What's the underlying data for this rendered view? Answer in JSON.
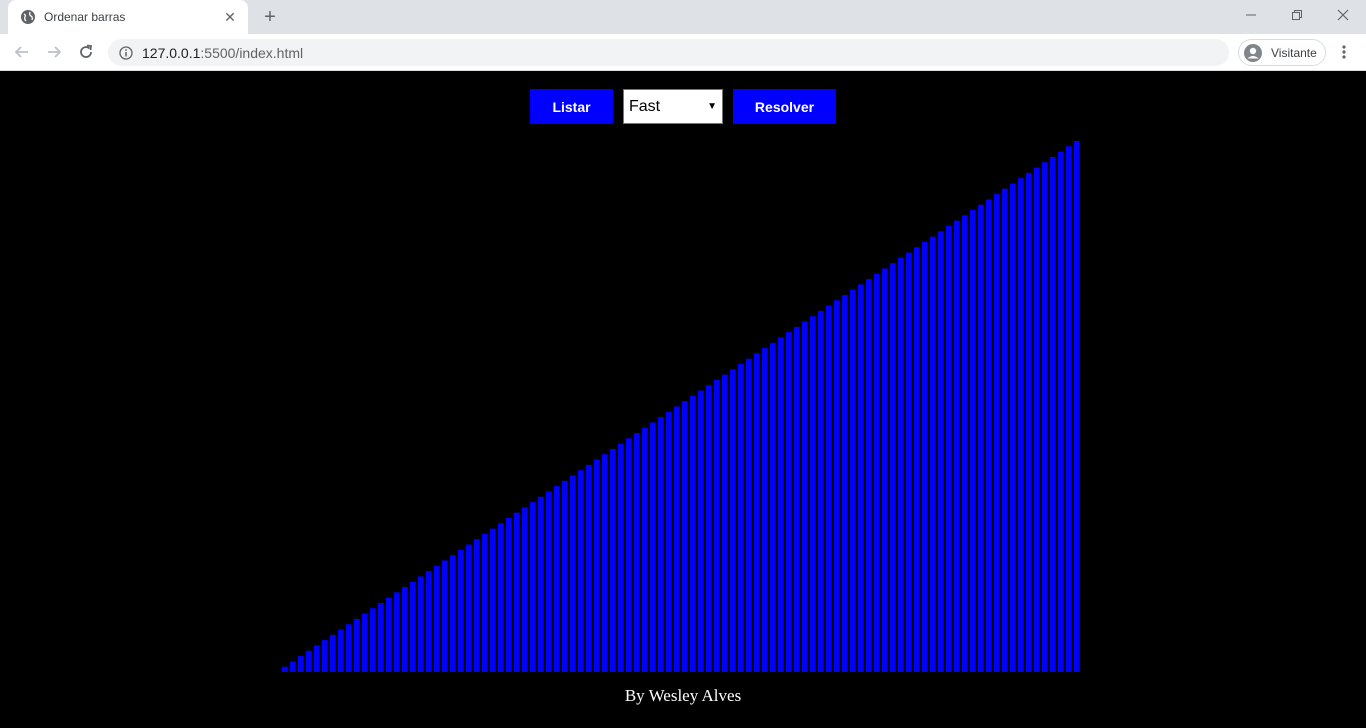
{
  "browser": {
    "tab_title": "Ordenar barras",
    "url_host": "127.0.0.1",
    "url_rest": ":5500/index.html",
    "profile_label": "Visitante"
  },
  "controls": {
    "listar_label": "Listar",
    "speed_selected": "Fast",
    "resolver_label": "Resolver"
  },
  "footer": {
    "text": "By Wesley Alves"
  },
  "colors": {
    "bar": "#0000ff",
    "background": "#000000"
  },
  "chart_data": {
    "type": "bar",
    "bar_count": 100,
    "values": [
      1,
      2,
      3,
      4,
      5,
      6,
      7,
      8,
      9,
      10,
      11,
      12,
      13,
      14,
      15,
      16,
      17,
      18,
      19,
      20,
      21,
      22,
      23,
      24,
      25,
      26,
      27,
      28,
      29,
      30,
      31,
      32,
      33,
      34,
      35,
      36,
      37,
      38,
      39,
      40,
      41,
      42,
      43,
      44,
      45,
      46,
      47,
      48,
      49,
      50,
      51,
      52,
      53,
      54,
      55,
      56,
      57,
      58,
      59,
      60,
      61,
      62,
      63,
      64,
      65,
      66,
      67,
      68,
      69,
      70,
      71,
      72,
      73,
      74,
      75,
      76,
      77,
      78,
      79,
      80,
      81,
      82,
      83,
      84,
      85,
      86,
      87,
      88,
      89,
      90,
      91,
      92,
      93,
      94,
      95,
      96,
      97,
      98,
      99,
      100
    ],
    "grid": false
  }
}
